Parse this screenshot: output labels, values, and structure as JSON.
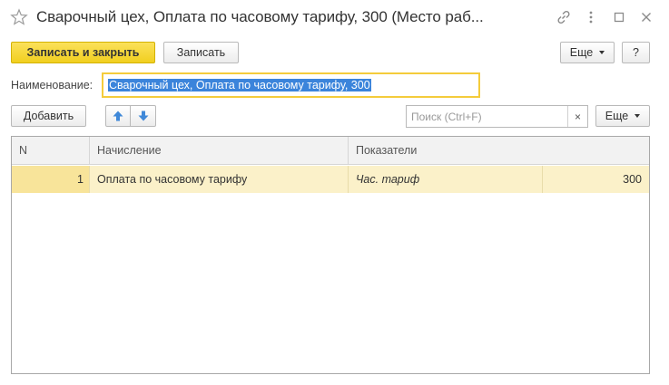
{
  "window": {
    "title": "Сварочный цех, Оплата по часовому тарифу, 300 (Место раб..."
  },
  "toolbar": {
    "save_close_label": "Записать и закрыть",
    "save_label": "Записать",
    "more_label": "Еще",
    "help_label": "?"
  },
  "form": {
    "name_label": "Наименование:",
    "name_value": "Сварочный цех, Оплата по часовому тарифу, 300"
  },
  "table_toolbar": {
    "add_label": "Добавить",
    "search_placeholder": "Поиск (Ctrl+F)",
    "clear_label": "×",
    "more_label": "Еще"
  },
  "table": {
    "columns": [
      "N",
      "Начисление",
      "Показатели"
    ],
    "rows": [
      {
        "n": "1",
        "accrual": "Оплата по часовому тарифу",
        "indicator": "Час. тариф",
        "value": "300"
      }
    ]
  },
  "colors": {
    "primary_button": "#f1cf1f",
    "focus_border": "#f4cc3b",
    "selected_row": "#fbf1c9",
    "selection_highlight": "#3b84db"
  }
}
